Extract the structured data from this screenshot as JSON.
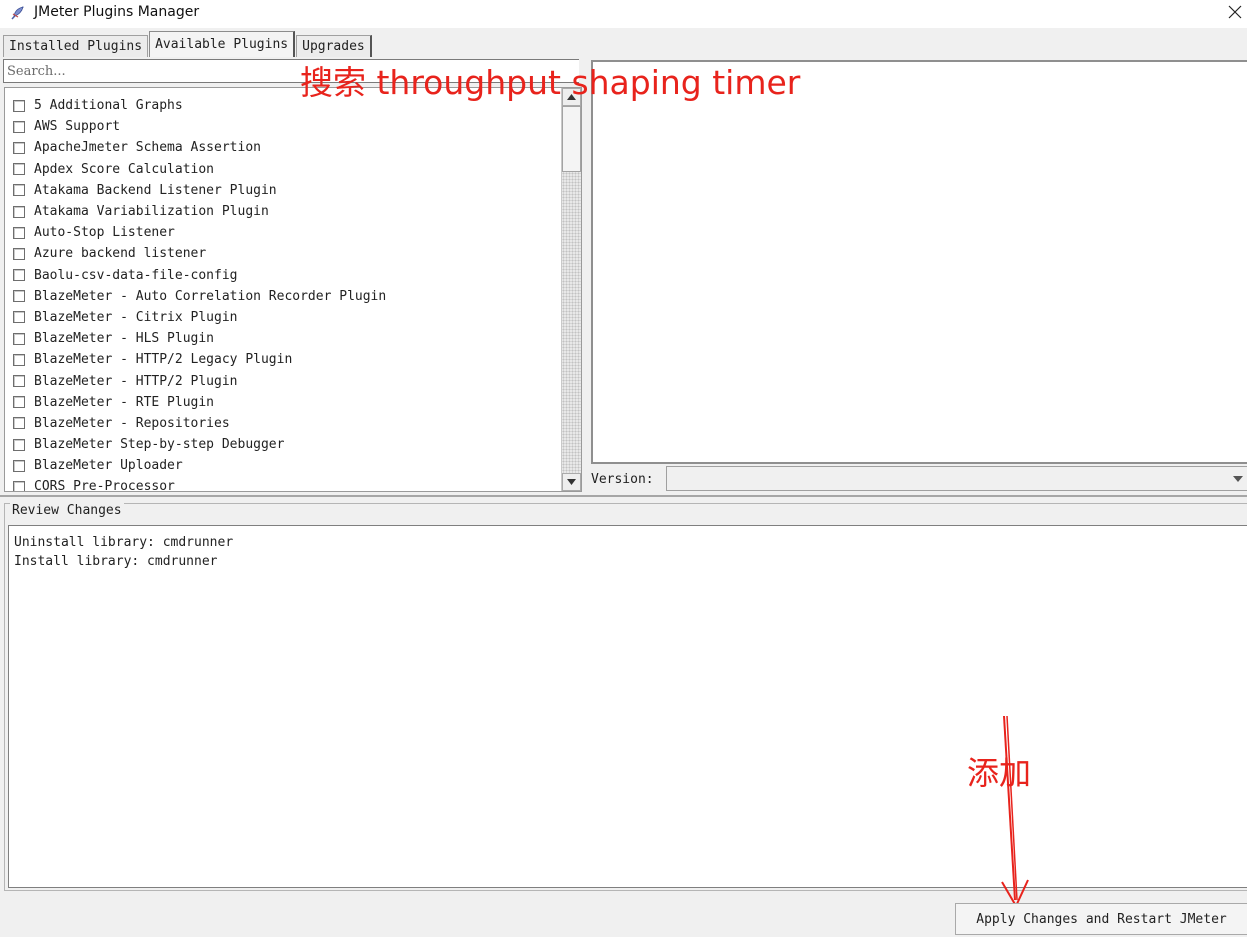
{
  "window": {
    "title": "JMeter Plugins Manager",
    "close_glyph": "✕",
    "icon": "feather-icon"
  },
  "tabs": [
    {
      "label": "Installed Plugins",
      "active": false
    },
    {
      "label": "Available Plugins",
      "active": true
    },
    {
      "label": "Upgrades",
      "active": false
    }
  ],
  "search": {
    "placeholder": "Search...",
    "value": ""
  },
  "plugins": [
    {
      "name": "5 Additional Graphs",
      "checked": false
    },
    {
      "name": "AWS Support",
      "checked": false
    },
    {
      "name": "ApacheJmeter Schema Assertion",
      "checked": false
    },
    {
      "name": "Apdex Score Calculation",
      "checked": false
    },
    {
      "name": "Atakama Backend Listener Plugin",
      "checked": false
    },
    {
      "name": "Atakama Variabilization Plugin",
      "checked": false
    },
    {
      "name": "Auto-Stop Listener",
      "checked": false
    },
    {
      "name": "Azure backend listener",
      "checked": false
    },
    {
      "name": "Baolu-csv-data-file-config",
      "checked": false
    },
    {
      "name": "BlazeMeter - Auto Correlation Recorder Plugin",
      "checked": false
    },
    {
      "name": "BlazeMeter - Citrix Plugin",
      "checked": false
    },
    {
      "name": "BlazeMeter - HLS Plugin",
      "checked": false
    },
    {
      "name": "BlazeMeter - HTTP/2 Legacy Plugin",
      "checked": false
    },
    {
      "name": "BlazeMeter - HTTP/2 Plugin",
      "checked": false
    },
    {
      "name": "BlazeMeter - RTE Plugin",
      "checked": false
    },
    {
      "name": "BlazeMeter - Repositories",
      "checked": false
    },
    {
      "name": "BlazeMeter Step-by-step Debugger",
      "checked": false
    },
    {
      "name": "BlazeMeter Uploader",
      "checked": false
    },
    {
      "name": "CORS Pre-Processor",
      "checked": false
    }
  ],
  "details": {
    "version_label": "Version:",
    "version_value": ""
  },
  "review": {
    "title": "Review Changes",
    "lines": [
      "Uninstall library: cmdrunner",
      "Install library: cmdrunner"
    ]
  },
  "apply_button": "Apply Changes and Restart JMeter",
  "annotations": {
    "search_hint": "搜索 throughput shaping timer",
    "add_hint": "添加",
    "color": "#e8231c"
  }
}
